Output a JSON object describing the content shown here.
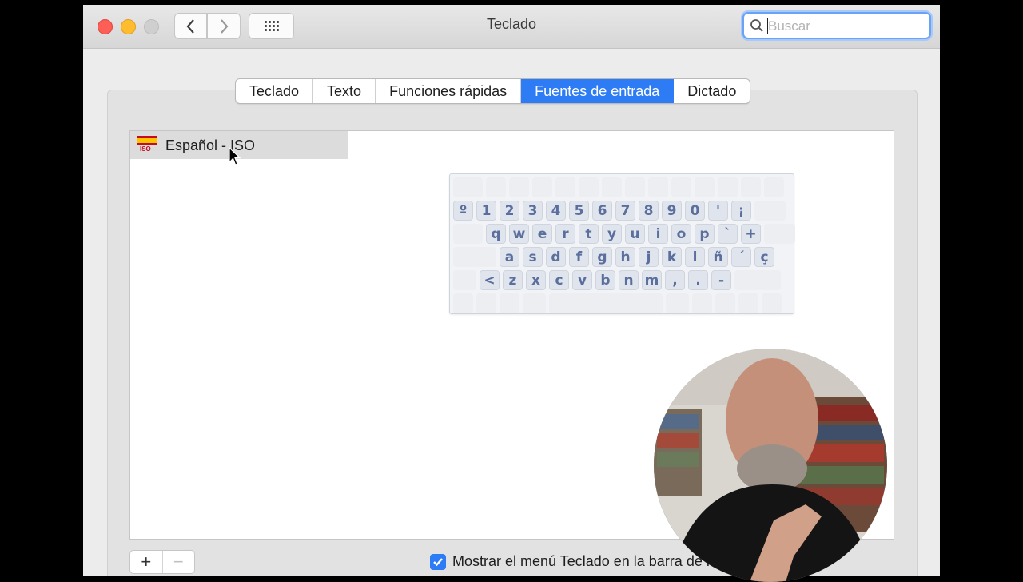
{
  "window": {
    "title": "Teclado",
    "search": {
      "placeholder": "Buscar"
    }
  },
  "tabs": [
    {
      "label": "Teclado",
      "active": false
    },
    {
      "label": "Texto",
      "active": false
    },
    {
      "label": "Funciones rápidas",
      "active": false
    },
    {
      "label": "Fuentes de entrada",
      "active": true
    },
    {
      "label": "Dictado",
      "active": false
    }
  ],
  "input_sources": [
    {
      "label": "Español - ISO",
      "flag_badge": "ISO",
      "selected": true
    }
  ],
  "keyboard_rows": [
    [
      "º",
      "1",
      "2",
      "3",
      "4",
      "5",
      "6",
      "7",
      "8",
      "9",
      "0",
      "'",
      "¡"
    ],
    [
      "q",
      "w",
      "e",
      "r",
      "t",
      "y",
      "u",
      "i",
      "o",
      "p",
      "`",
      "+"
    ],
    [
      "a",
      "s",
      "d",
      "f",
      "g",
      "h",
      "j",
      "k",
      "l",
      "ñ",
      "´",
      "ç"
    ],
    [
      "<",
      "z",
      "x",
      "c",
      "v",
      "b",
      "n",
      "m",
      ",",
      ".",
      "-"
    ]
  ],
  "bottom": {
    "add_label": "+",
    "remove_label": "−",
    "show_menu_label": "Mostrar el menú Teclado en la barra de menús",
    "show_menu_checked": true
  },
  "colors": {
    "accent": "#2d7cf6",
    "close": "#fd5f57",
    "minimize": "#febc2e",
    "key_text": "#5a6f9d"
  }
}
